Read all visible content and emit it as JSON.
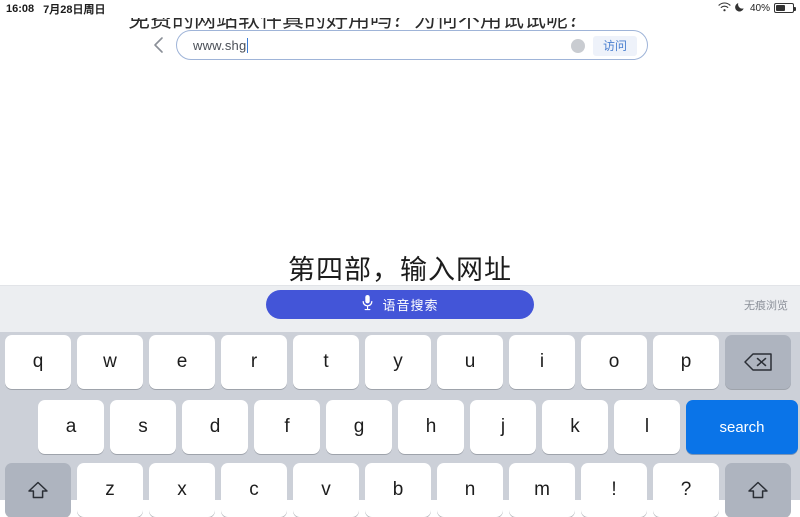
{
  "status_bar": {
    "time": "16:08",
    "date": "7月28日周日",
    "battery_percent": "40%",
    "icons": [
      "wifi-icon",
      "do-not-disturb-moon-icon",
      "battery-icon"
    ]
  },
  "headline": {
    "text": "免费的网站软件真的好用吗？为何不用试试呢？"
  },
  "browser": {
    "back_icon": "chevron-left-icon",
    "url_value": "www.shg",
    "clear_icon": "clear-circle-icon",
    "go_label": "访问"
  },
  "caption": {
    "text": "第四部，输入网址"
  },
  "suggestion_bar": {
    "voice_icon": "microphone-icon",
    "voice_label": "语音搜索",
    "incognito_label": "无痕浏览"
  },
  "keyboard": {
    "row1": [
      "q",
      "w",
      "e",
      "r",
      "t",
      "y",
      "u",
      "i",
      "o",
      "p"
    ],
    "row1_action": {
      "name": "backspace-key",
      "icon": "backspace-icon"
    },
    "row2": [
      "a",
      "s",
      "d",
      "f",
      "g",
      "h",
      "j",
      "k",
      "l"
    ],
    "row2_action": {
      "name": "search-key",
      "label": "search"
    },
    "row3_left_action": {
      "name": "shift-key-left",
      "icon": "shift-arrow-icon"
    },
    "row3": [
      "z",
      "x",
      "c",
      "v",
      "b",
      "n",
      "m",
      "!",
      "?"
    ],
    "row3_right_action": {
      "name": "shift-key-right",
      "icon": "shift-arrow-icon"
    }
  },
  "colors": {
    "accent_blue": "#0a74e8",
    "voice_blue": "#4355d8",
    "keyboard_bg": "#ccd0d8",
    "key_white": "#ffffff",
    "mod_key_grey": "#aeb4bf",
    "suggestion_bg": "#eceef1"
  }
}
